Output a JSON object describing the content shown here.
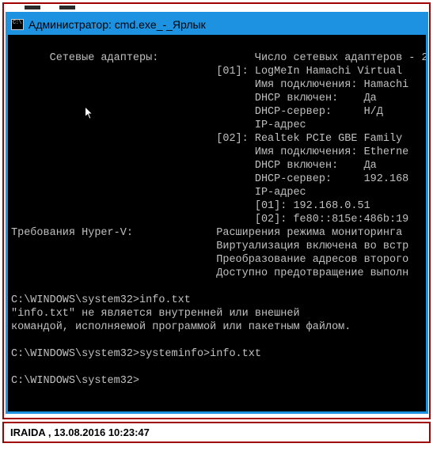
{
  "window": {
    "title": "Администратор: cmd.exe_-_Ярлык"
  },
  "terminal": {
    "lines": [
      "Сетевые адаптеры:               Число сетевых адаптеров - 2.",
      "                                [01]: LogMeIn Hamachi Virtual ",
      "                                      Имя подключения: Hamachi",
      "                                      DHCP включен:    Да",
      "                                      DHCP-сервер:     Н/Д",
      "                                      IP-адрес",
      "                                [02]: Realtek PCIe GBE Family ",
      "                                      Имя подключения: Etherne",
      "                                      DHCP включен:    Да",
      "                                      DHCP-сервер:     192.168",
      "                                      IP-адрес",
      "                                      [01]: 192.168.0.51",
      "                                      [02]: fe80::815e:486b:19",
      "Требования Hyper-V:             Расширения режима мониторинга ",
      "                                Виртуализация включена во встр",
      "                                Преобразование адресов второго",
      "                                Доступно предотвращение выполн",
      "",
      "C:\\WINDOWS\\system32>info.txt",
      "\"info.txt\" не является внутренней или внешней",
      "командой, исполняемой программой или пакетным файлом.",
      "",
      "C:\\WINDOWS\\system32>systeminfo>info.txt",
      "",
      "C:\\WINDOWS\\system32>"
    ]
  },
  "footer": {
    "author": "IRAIDA ",
    "sep": " ,  ",
    "datetime": "13.08.2016 10:23:47"
  }
}
